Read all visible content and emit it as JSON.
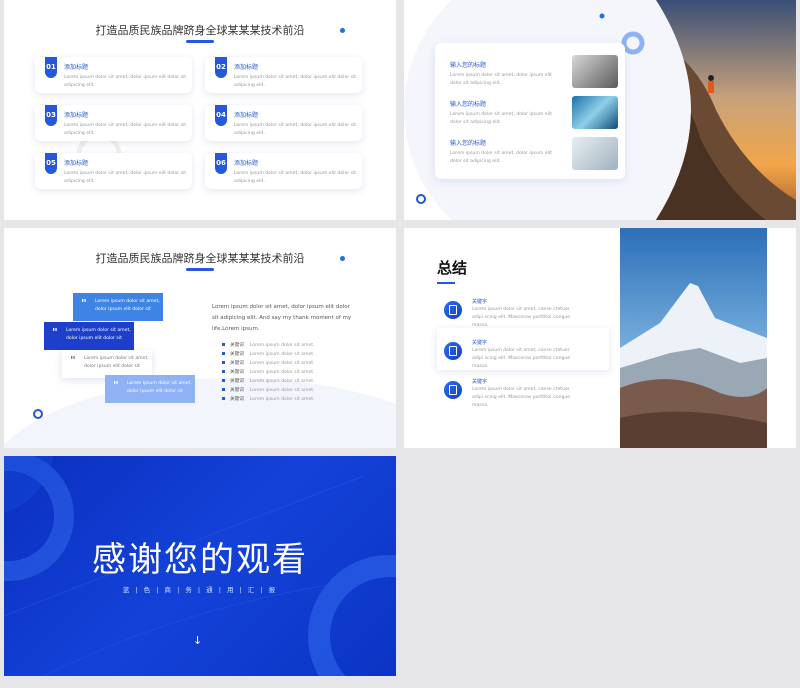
{
  "slide1": {
    "title": "打造品质民族品牌跻身全球某某某技术前沿",
    "cards": [
      {
        "num": "01",
        "title": "添加标题",
        "body": "Lorem ipsum dolor sit amet, dolor ipsum elit dolor sit adipicing elit."
      },
      {
        "num": "02",
        "title": "添加标题",
        "body": "Lorem ipsum dolor sit amet, dolor ipsum elit dolor sit adipicing elit."
      },
      {
        "num": "03",
        "title": "添加标题",
        "body": "Lorem ipsum dolor sit amet, dolor ipsum elit dolor sit adipicing elit."
      },
      {
        "num": "04",
        "title": "添加标题",
        "body": "Lorem ipsum dolor sit amet, dolor ipsum elit dolor sit adipicing elit."
      },
      {
        "num": "05",
        "title": "添加标题",
        "body": "Lorem ipsum dolor sit amet, dolor ipsum elit dolor sit adipicing elit."
      },
      {
        "num": "06",
        "title": "添加标题",
        "body": "Lorem ipsum dolor sit amet, dolor ipsum elit dolor sit adipicing elit."
      }
    ]
  },
  "slide2": {
    "items": [
      {
        "title": "输入您的标题",
        "body": "Lorem ipsum dolor sit amet, dolor ipsum elit dolor sit adipicing elit."
      },
      {
        "title": "输入您的标题",
        "body": "Lorem ipsum dolor sit amet, dolor ipsum elit dolor sit adipicing elit."
      },
      {
        "title": "输入您的标题",
        "body": "Lorem ipsum dolor sit amet, dolor ipsum elit dolor sit adipicing elit."
      }
    ]
  },
  "slide3": {
    "title": "打造品质民族品牌跻身全球某某某技术前沿",
    "bubbles": [
      "Lorem ipsum dolor sit amet, dolor ipsum elit dolor sit",
      "Lorem ipsum dolor sit amet, dolor ipsum elit dolor sit",
      "Lorem ipsum dolor sit amet, dolor ipsum elit dolor sit",
      "Lorem ipsum dolor sit amet, dolor ipsum elit dolor sit"
    ],
    "paragraph": "Lorem ipsum dolor sit amet, dolor ipsum elit dolor sit adipicing elit. And say my thank moment of my life.Lorem ipsum.",
    "bullets": [
      {
        "key": "关键词",
        "text": "Lorem ipsum dolor sit amet."
      },
      {
        "key": "关键词",
        "text": "Lorem ipsum dolor sit amet."
      },
      {
        "key": "关键词",
        "text": "Lorem ipsum dolor sit amet."
      },
      {
        "key": "关键词",
        "text": "Lorem ipsum dolor sit amet."
      },
      {
        "key": "关键词",
        "text": "Lorem ipsum dolor sit amet."
      },
      {
        "key": "关键词",
        "text": "Lorem ipsum dolor sit amet."
      },
      {
        "key": "关键词",
        "text": "Lorem ipsum dolor sit amet."
      }
    ]
  },
  "slide4": {
    "title": "总结",
    "items": [
      {
        "key": "关键字",
        "text": "Lorem ipsum dolor sit amet, conse ctetuer adipi scing elit. Maecenas porttitor congue massa."
      },
      {
        "key": "关键字",
        "text": "Lorem ipsum dolor sit amet, conse ctetuer adipi scing elit. Maecenas porttitor congue massa."
      },
      {
        "key": "关键字",
        "text": "Lorem ipsum dolor sit amet, conse ctetuer adipi scing elit. Maecenas porttitor congue massa."
      }
    ]
  },
  "slide5": {
    "title": "感谢您的观看",
    "subtitle": "蓝 | 色 | 商 | 务 | 通 | 用 | 汇 | 报",
    "arrow": "↓"
  },
  "colors": {
    "primary": "#2458d8",
    "deep": "#1038c0",
    "light": "#8fb2f4"
  }
}
